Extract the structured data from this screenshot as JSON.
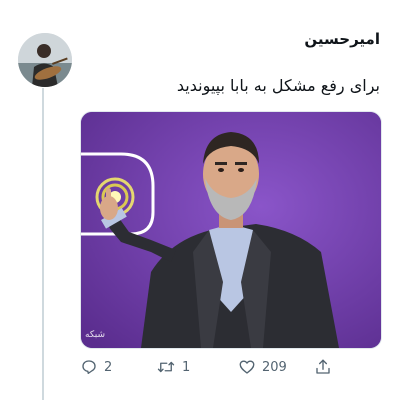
{
  "tweet": {
    "author_name": "امیرحسین",
    "text": "برای رفع مشکل به بابا بپیوندید",
    "media": {
      "watermark": "شبکه",
      "background_color": "#6d3fa6"
    }
  },
  "actions": {
    "reply": {
      "icon": "reply-icon",
      "count": "2"
    },
    "retweet": {
      "icon": "retweet-icon",
      "count": "1"
    },
    "like": {
      "icon": "heart-icon",
      "count": "209"
    },
    "share": {
      "icon": "share-icon"
    }
  },
  "colors": {
    "text": "#0f1419",
    "secondary": "#536471",
    "thread_line": "#cfd9de",
    "media_bg": "#6d3fa6"
  }
}
